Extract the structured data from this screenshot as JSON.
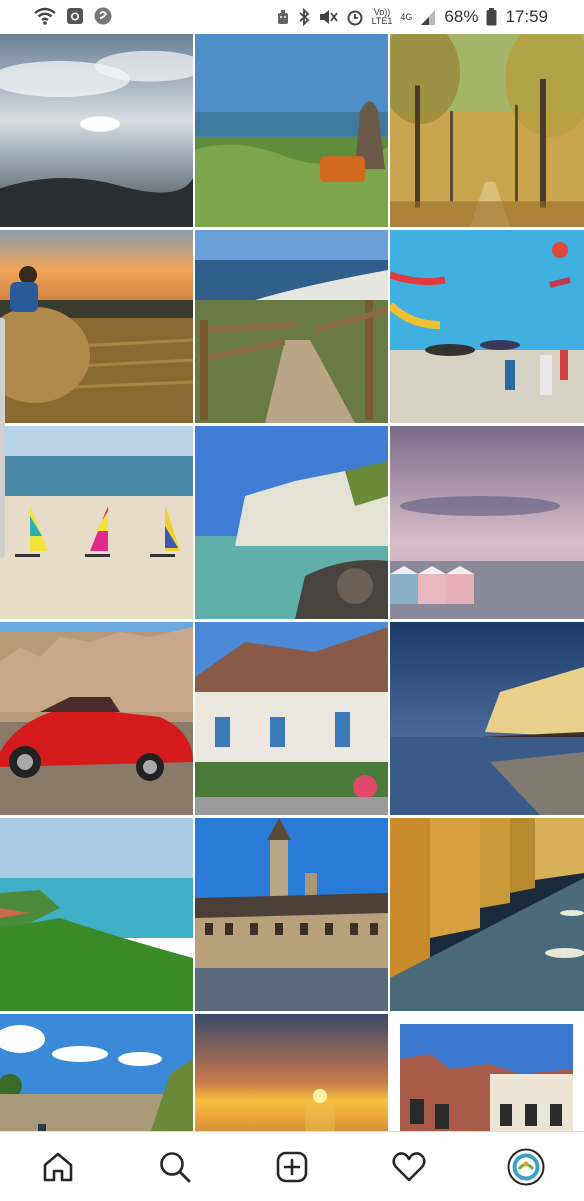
{
  "status_bar": {
    "battery_percent": "68%",
    "time": "17:59",
    "network_volte": "Vo))",
    "network_lte": "LTE1",
    "network_4g": "4G",
    "icons_left": [
      "wifi-icon",
      "instagram-icon",
      "shazam-icon"
    ],
    "icons_right": [
      "bluetooth-icon",
      "mute-icon",
      "alarm-icon",
      "signal-icon",
      "battery-icon"
    ]
  },
  "grid": {
    "photos": [
      {
        "name": "sunset-sea-clouds"
      },
      {
        "name": "woman-dunes-sea"
      },
      {
        "name": "autumn-tree-alley"
      },
      {
        "name": "man-on-haybale-sunset"
      },
      {
        "name": "wooden-steps-to-beach"
      },
      {
        "name": "kite-festival-beach"
      },
      {
        "name": "sand-yachts-beach"
      },
      {
        "name": "white-chalk-cliffs"
      },
      {
        "name": "beach-huts-dusk"
      },
      {
        "name": "red-sports-car-square"
      },
      {
        "name": "village-houses-blue-shutters"
      },
      {
        "name": "golden-cliff-sea"
      },
      {
        "name": "green-cliffs-coast"
      },
      {
        "name": "belfry-town-square"
      },
      {
        "name": "illuminated-memorial-walls"
      },
      {
        "name": "ramparts-walker"
      },
      {
        "name": "golden-sunset-sea"
      },
      {
        "name": "brick-townhouses"
      }
    ]
  },
  "bottom_nav": {
    "items": [
      "home-icon",
      "search-icon",
      "add-post-icon",
      "activity-heart-icon",
      "profile-avatar-icon"
    ]
  }
}
